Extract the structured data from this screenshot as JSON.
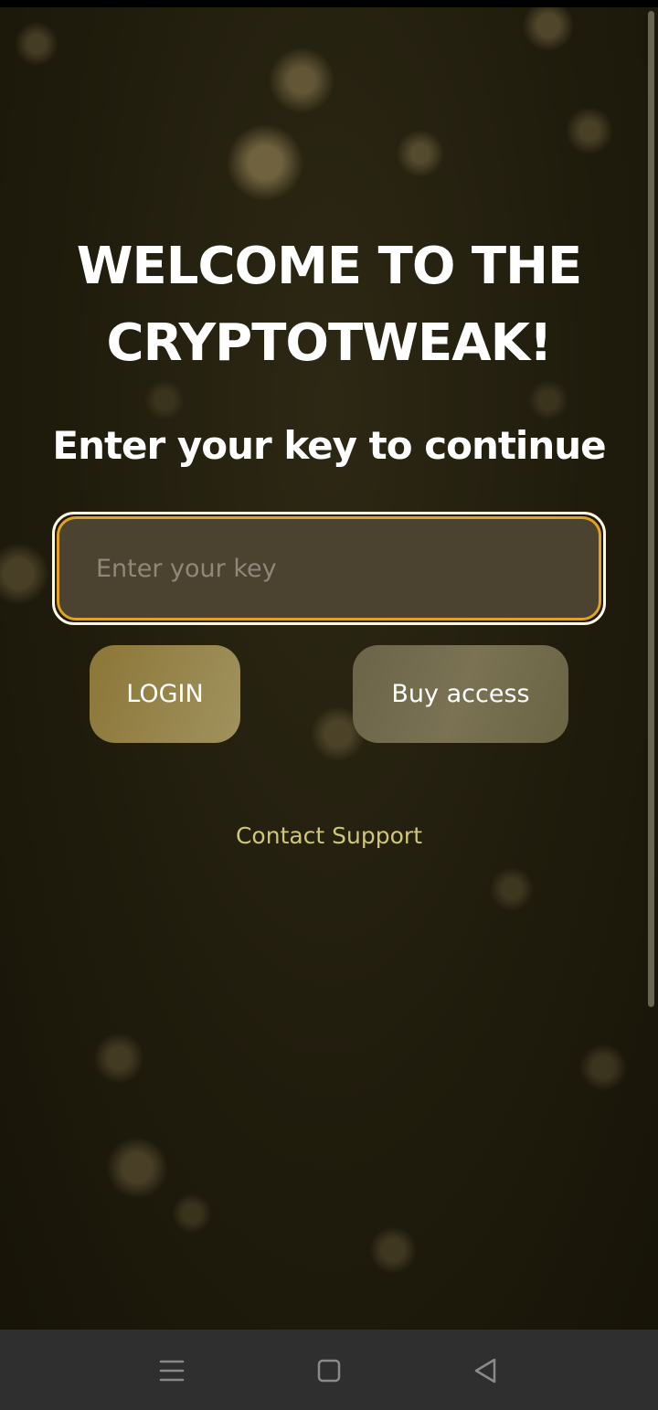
{
  "welcome": {
    "title_line1": "WELCOME TO THE",
    "title_line2": "CRYPTOTWEAK!",
    "subtitle": "Enter your key to continue"
  },
  "key_field": {
    "placeholder": "Enter your key",
    "value": ""
  },
  "buttons": {
    "login_label": "LOGIN",
    "buy_label": "Buy access"
  },
  "support": {
    "label": "Contact Support"
  },
  "system_nav": {
    "icons": [
      "menu-icon",
      "home-icon",
      "back-icon"
    ]
  },
  "colors": {
    "input_border": "#e1a21f",
    "input_background": "#4b432f",
    "login_button": "#8c7637",
    "buy_button": "#6b6448",
    "support_link": "#cfc67a",
    "background": "#1f1b0c",
    "navbar": "#2f2f2f"
  }
}
